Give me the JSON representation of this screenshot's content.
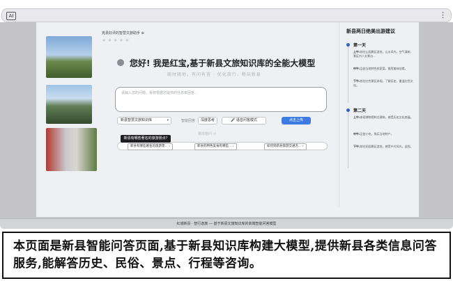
{
  "browser": {
    "app_icon": "AI",
    "menu_icon": "⋮"
  },
  "assistant": {
    "logo_text": "克县好评的智慧文旅助手 ⊕",
    "stars": "★★★★★",
    "greeting": "您好! 我是红宝,基于新县文旅知识库的全能大模型",
    "subtitle": "随时随地，有问有答 · 优化旅行，畅玩新县",
    "input_placeholder": "请输入您的问题，我将根据您提供的信息来回答...",
    "kb_select": "新县智慧文旅知识库",
    "kb_caret": "▾",
    "mode_label": "智能回答",
    "deep_btn": "深度思考",
    "voice_btn": "🎤 语音问答模式",
    "send_btn": "点击上传",
    "hint": "猜你想问 ↺",
    "tooltip": "新县有哪些著名的旅游景点?",
    "chips": [
      "新县有哪些著名的旅游景... ›",
      "新县的特色美食有哪些... ›",
      "如何到新县旅游交通方... ›"
    ]
  },
  "itinerary": {
    "title": "新县两日绝美出游建议",
    "days": [
      {
        "label": "第一天",
        "items": [
          {
            "time": "上午:",
            "text": "前往山园景区游览，山水风光，空气清新，景区内人文景点..."
          },
          {
            "time": "中午:",
            "text": "品尝当地特色农家菜，推荐美味佳肴。"
          },
          {
            "time": "下午:",
            "text": "前往红色景区参观，了解历史，重温红色文化。"
          }
        ]
      },
      {
        "label": "第二天",
        "items": [
          {
            "time": "上午:",
            "text": "参观博物馆和古建筑，感受历史文化底蕴。"
          },
          {
            "time": "中午:",
            "text": "品尝小吃，购买当地特产。"
          },
          {
            "time": "下午:",
            "text": "前往田园景区游览，感受乡村风光，返程。"
          }
        ]
      }
    ]
  },
  "footer": "红城新县 · 智行逸旅 — 基于新县文旅知识库的高端智能问答模型",
  "caption": "本页面是新县智能问答页面,基于新县知识库构建大模型,提供新县各类信息问答服务,能解答历史、民俗、景点、行程等咨询。"
}
